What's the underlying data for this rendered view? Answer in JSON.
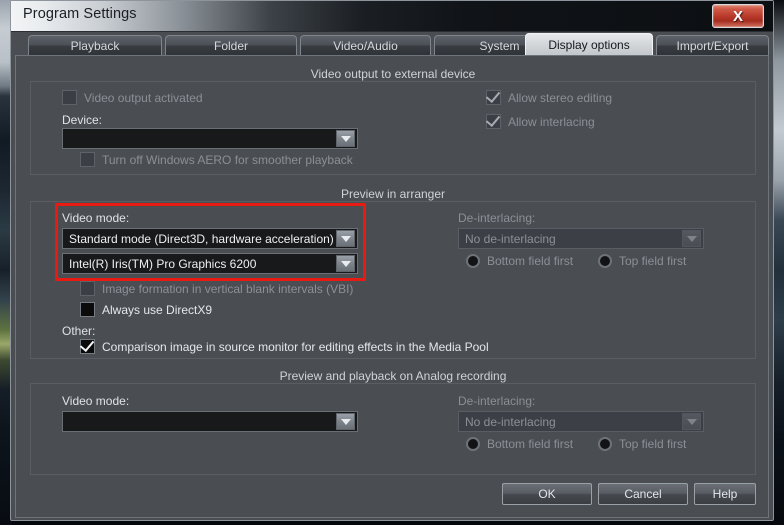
{
  "window": {
    "title": "Program Settings",
    "close_label": "X"
  },
  "tabs": [
    {
      "label": "Playback",
      "active": false
    },
    {
      "label": "Folder",
      "active": false
    },
    {
      "label": "Video/Audio",
      "active": false
    },
    {
      "label": "System",
      "active": false
    },
    {
      "label": "Display options",
      "active": true
    },
    {
      "label": "Import/Export",
      "active": false
    }
  ],
  "sections": {
    "external_device": {
      "header": "Video output to external device",
      "video_output_activated": "Video output activated",
      "device_label": "Device:",
      "device_value": "",
      "aero_label": "Turn off Windows AERO for smoother playback",
      "allow_stereo": "Allow stereo editing",
      "allow_interlacing": "Allow interlacing"
    },
    "preview_arranger": {
      "header": "Preview in arranger",
      "video_mode_label": "Video mode:",
      "video_mode_value": "Standard mode (Direct3D, hardware acceleration)",
      "graphics_device_value": "Intel(R) Iris(TM) Pro Graphics 6200",
      "vbi_label": "Image formation in vertical blank intervals (VBI)",
      "directx9_label": "Always use DirectX9",
      "other_label": "Other:",
      "comparison_label": "Comparison image in source monitor for editing effects in the Media Pool",
      "deinterlacing_label": "De-interlacing:",
      "deinterlacing_value": "No de-interlacing",
      "bottom_field_first": "Bottom field first",
      "top_field_first": "Top field first"
    },
    "analog_recording": {
      "header": "Preview and playback on Analog recording",
      "video_mode_label": "Video mode:",
      "video_mode_value": "",
      "deinterlacing_label": "De-interlacing:",
      "deinterlacing_value": "No de-interlacing",
      "bottom_field_first": "Bottom field first",
      "top_field_first": "Top field first"
    }
  },
  "buttons": {
    "ok": "OK",
    "cancel": "Cancel",
    "help": "Help"
  },
  "colors": {
    "highlight": "#e81b12",
    "dialog_bg": "#4a4d52",
    "accent_close": "#b8392a"
  }
}
